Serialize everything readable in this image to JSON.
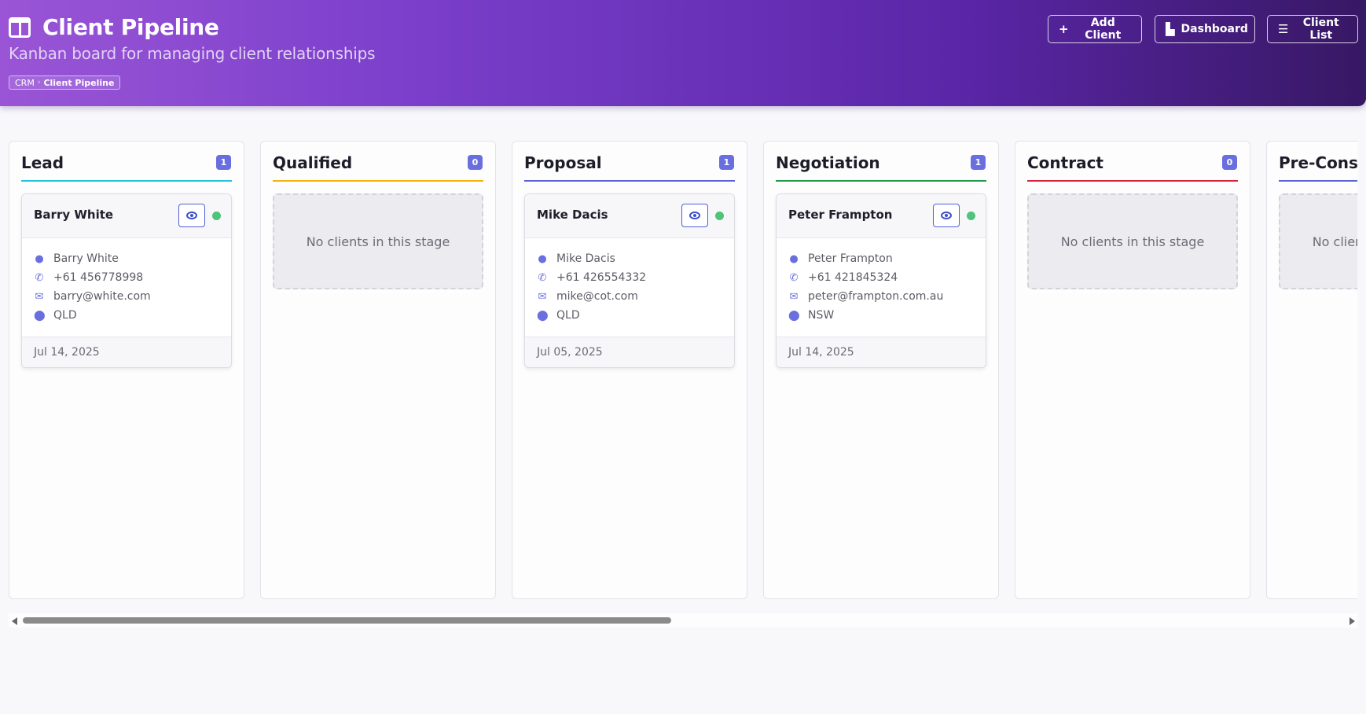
{
  "header": {
    "title": "Client Pipeline",
    "subtitle": "Kanban board for managing client relationships",
    "breadcrumb": {
      "root": "CRM",
      "current": "Client Pipeline"
    },
    "buttons": {
      "add_client": "Add Client",
      "dashboard": "Dashboard",
      "client_list": "Client List"
    }
  },
  "empty_text": "No clients in this stage",
  "columns": [
    {
      "title": "Lead",
      "count": "1",
      "color": "#22c5d8",
      "card": {
        "name": "Barry White",
        "contact": "Barry White",
        "phone": "+61 456778998",
        "email": "barry@white.com",
        "location": "QLD",
        "date": "Jul 14, 2025"
      }
    },
    {
      "title": "Qualified",
      "count": "0",
      "color": "#f2b10c"
    },
    {
      "title": "Proposal",
      "count": "1",
      "color": "#5b63d6",
      "card": {
        "name": "Mike Dacis",
        "contact": "Mike Dacis",
        "phone": "+61 426554332",
        "email": "mike@cot.com",
        "location": "QLD",
        "date": "Jul 05, 2025"
      }
    },
    {
      "title": "Negotiation",
      "count": "1",
      "color": "#1f9a4b",
      "card": {
        "name": "Peter Frampton",
        "contact": "Peter Frampton",
        "phone": "+61 421845324",
        "email": "peter@frampton.com.au",
        "location": "NSW",
        "date": "Jul 14, 2025"
      }
    },
    {
      "title": "Contract",
      "count": "0",
      "color": "#d8243a"
    },
    {
      "title": "Pre-Const",
      "count": "",
      "color": "#5b63d6"
    }
  ],
  "colors": {
    "status_active": "#4fc37a",
    "accent": "#6a6fe0"
  },
  "icons": {
    "header": "kanban-icon",
    "contact": "user-icon",
    "phone": "phone-icon",
    "email": "envelope-icon",
    "location": "map-pin-icon",
    "view": "eye-icon"
  }
}
